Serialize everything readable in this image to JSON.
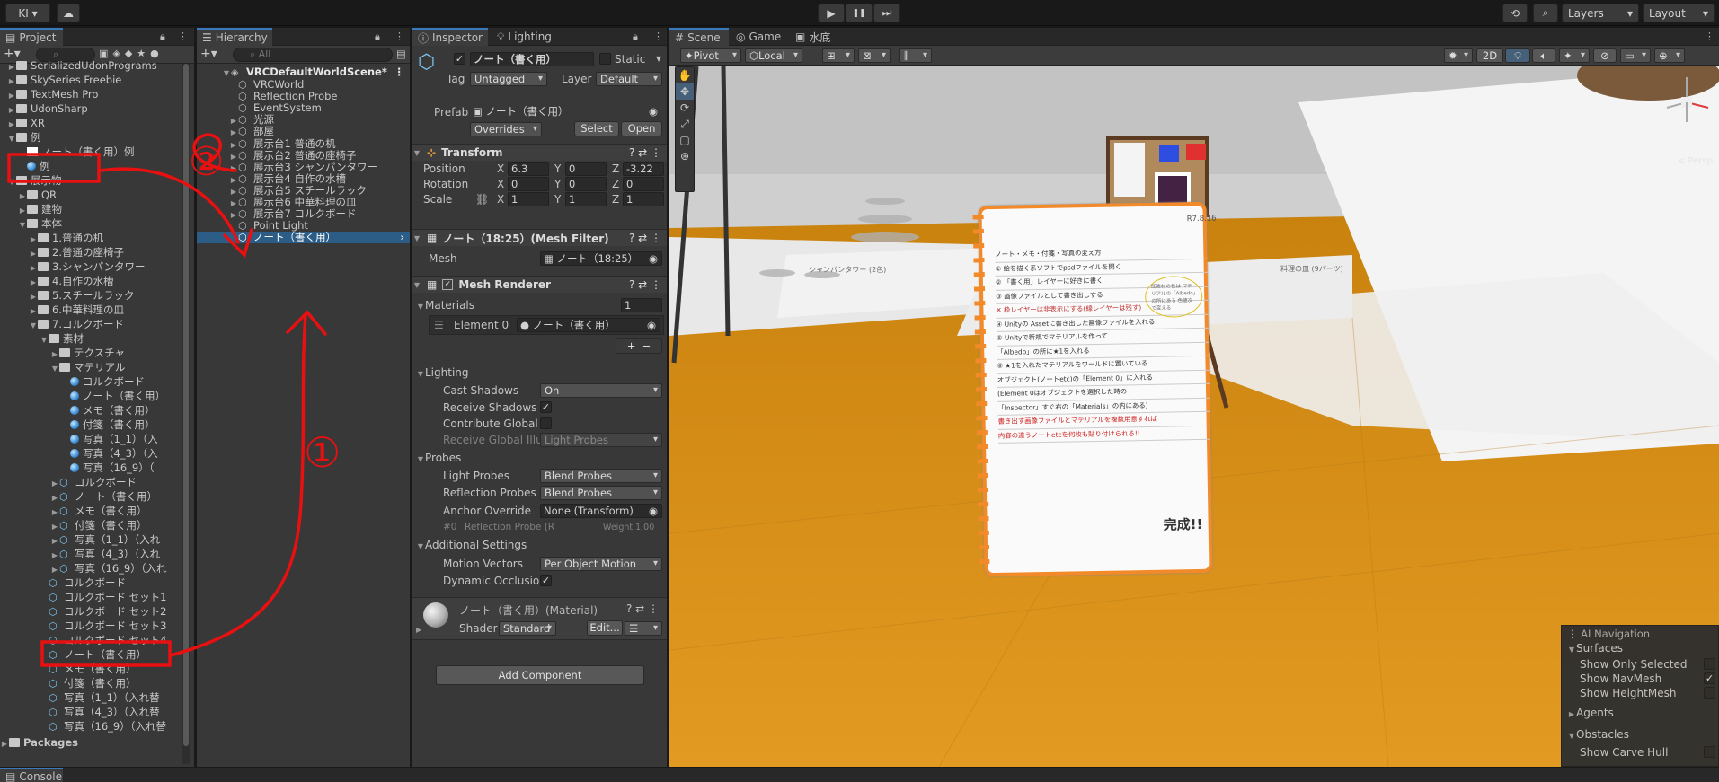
{
  "topbar": {
    "account": "KI",
    "play_icon": "▶",
    "pause_icon": "❚❚",
    "step_icon": "⏭",
    "layers": "Layers",
    "layout": "Layout"
  },
  "project": {
    "tab": "Project",
    "items": [
      {
        "label": "SerializedUdonPrograms",
        "indent": 1,
        "type": "folder",
        "arrow": "▶"
      },
      {
        "label": "SkySeries Freebie",
        "indent": 1,
        "type": "folder",
        "arrow": "▶"
      },
      {
        "label": "TextMesh Pro",
        "indent": 1,
        "type": "folder",
        "arrow": "▶"
      },
      {
        "label": "UdonSharp",
        "indent": 1,
        "type": "folder",
        "arrow": "▶"
      },
      {
        "label": "XR",
        "indent": 1,
        "type": "folder",
        "arrow": "▶"
      },
      {
        "label": "例",
        "indent": 1,
        "type": "folder",
        "arrow": "▼"
      },
      {
        "label": "ノート（書く用）例",
        "indent": 2,
        "type": "white",
        "arrow": ""
      },
      {
        "label": "例",
        "indent": 2,
        "type": "mat",
        "arrow": ""
      },
      {
        "label": "展示物",
        "indent": 1,
        "type": "folder",
        "arrow": "▼"
      },
      {
        "label": "QR",
        "indent": 2,
        "type": "folder",
        "arrow": "▶"
      },
      {
        "label": "建物",
        "indent": 2,
        "type": "folder",
        "arrow": "▶"
      },
      {
        "label": "本体",
        "indent": 2,
        "type": "folder",
        "arrow": "▼"
      },
      {
        "label": "1.普通の机",
        "indent": 3,
        "type": "folder",
        "arrow": "▶"
      },
      {
        "label": "2.普通の座椅子",
        "indent": 3,
        "type": "folder",
        "arrow": "▶"
      },
      {
        "label": "3.シャンパンタワー",
        "indent": 3,
        "type": "folder",
        "arrow": "▶"
      },
      {
        "label": "4.自作の水槽",
        "indent": 3,
        "type": "folder",
        "arrow": "▶"
      },
      {
        "label": "5.スチールラック",
        "indent": 3,
        "type": "folder",
        "arrow": "▶"
      },
      {
        "label": "6.中華料理の皿",
        "indent": 3,
        "type": "folder",
        "arrow": "▶"
      },
      {
        "label": "7.コルクボード",
        "indent": 3,
        "type": "folder",
        "arrow": "▼"
      },
      {
        "label": "素材",
        "indent": 4,
        "type": "folder",
        "arrow": "▼"
      },
      {
        "label": "テクスチャ",
        "indent": 5,
        "type": "folder",
        "arrow": "▶"
      },
      {
        "label": "マテリアル",
        "indent": 5,
        "type": "folder",
        "arrow": "▼"
      },
      {
        "label": "コルクボード",
        "indent": 6,
        "type": "mat",
        "arrow": ""
      },
      {
        "label": "ノート（書く用）",
        "indent": 6,
        "type": "mat",
        "arrow": ""
      },
      {
        "label": "メモ（書く用）",
        "indent": 6,
        "type": "mat",
        "arrow": ""
      },
      {
        "label": "付箋（書く用）",
        "indent": 6,
        "type": "mat",
        "arrow": ""
      },
      {
        "label": "写真（1_1）（入",
        "indent": 6,
        "type": "mat",
        "arrow": ""
      },
      {
        "label": "写真（4_3）（入",
        "indent": 6,
        "type": "mat",
        "arrow": ""
      },
      {
        "label": "写真（16_9）（",
        "indent": 6,
        "type": "mat",
        "arrow": ""
      },
      {
        "label": "コルクボード",
        "indent": 5,
        "type": "cube",
        "arrow": "▶"
      },
      {
        "label": "ノート（書く用）",
        "indent": 5,
        "type": "cube",
        "arrow": "▶"
      },
      {
        "label": "メモ（書く用）",
        "indent": 5,
        "type": "cube",
        "arrow": "▶"
      },
      {
        "label": "付箋（書く用）",
        "indent": 5,
        "type": "cube",
        "arrow": "▶"
      },
      {
        "label": "写真（1_1）（入れ",
        "indent": 5,
        "type": "cube",
        "arrow": "▶"
      },
      {
        "label": "写真（4_3）（入れ",
        "indent": 5,
        "type": "cube",
        "arrow": "▶"
      },
      {
        "label": "写真（16_9）（入れ",
        "indent": 5,
        "type": "cube",
        "arrow": "▶"
      },
      {
        "label": "コルクボード",
        "indent": 4,
        "type": "cube",
        "arrow": ""
      },
      {
        "label": "コルクボード セット1",
        "indent": 4,
        "type": "cube",
        "arrow": ""
      },
      {
        "label": "コルクボード セット2",
        "indent": 4,
        "type": "cube",
        "arrow": ""
      },
      {
        "label": "コルクボード セット3",
        "indent": 4,
        "type": "cube",
        "arrow": ""
      },
      {
        "label": "コルクボード セット4",
        "indent": 4,
        "type": "cube",
        "arrow": ""
      },
      {
        "label": "ノート（書く用）",
        "indent": 4,
        "type": "cube",
        "arrow": ""
      },
      {
        "label": "メモ（書く用）",
        "indent": 4,
        "type": "cube",
        "arrow": ""
      },
      {
        "label": "付箋（書く用）",
        "indent": 4,
        "type": "cube",
        "arrow": ""
      },
      {
        "label": "写真（1_1）（入れ替",
        "indent": 4,
        "type": "cube",
        "arrow": ""
      },
      {
        "label": "写真（4_3）（入れ替",
        "indent": 4,
        "type": "cube",
        "arrow": ""
      },
      {
        "label": "写真（16_9）（入れ替",
        "indent": 4,
        "type": "cube",
        "arrow": ""
      }
    ],
    "packages": "Packages"
  },
  "hierarchy": {
    "tab": "Hierarchy",
    "search_placeholder": "All",
    "scene": "VRCDefaultWorldScene*",
    "items": [
      {
        "label": "VRCWorld",
        "arrow": ""
      },
      {
        "label": "Reflection Probe",
        "arrow": ""
      },
      {
        "label": "EventSystem",
        "arrow": ""
      },
      {
        "label": "光源",
        "arrow": "▶"
      },
      {
        "label": "部屋",
        "arrow": "▶"
      },
      {
        "label": "展示台1 普通の机",
        "arrow": "▶"
      },
      {
        "label": "展示台2 普通の座椅子",
        "arrow": "▶"
      },
      {
        "label": "展示台3 シャンパンタワー",
        "arrow": "▶"
      },
      {
        "label": "展示台4 自作の水槽",
        "arrow": "▶"
      },
      {
        "label": "展示台5 スチールラック",
        "arrow": "▶"
      },
      {
        "label": "展示台6 中華料理の皿",
        "arrow": "▶"
      },
      {
        "label": "展示台7 コルクボード",
        "arrow": "▶"
      },
      {
        "label": "Point Light",
        "arrow": ""
      },
      {
        "label": "ノート（書く用）",
        "arrow": "",
        "selected": true,
        "cube": true
      }
    ]
  },
  "inspector": {
    "tab": "Inspector",
    "tab2": "Lighting",
    "object_name": "ノート（書く用）",
    "static": "Static",
    "tag_label": "Tag",
    "tag": "Untagged",
    "layer_label": "Layer",
    "layer": "Default",
    "prefab_label": "Prefab",
    "prefab": "ノート（書く用）",
    "overrides": "Overrides",
    "select": "Select",
    "open": "Open",
    "transform": {
      "title": "Transform",
      "position": "Position",
      "rotation": "Rotation",
      "scale": "Scale",
      "pos": [
        "6.3",
        "0",
        "-3.22"
      ],
      "rot": [
        "0",
        "0",
        "0"
      ],
      "scl": [
        "1",
        "1",
        "1"
      ],
      "x": "X",
      "y": "Y",
      "z": "Z"
    },
    "meshfilter": {
      "title": "ノート（18:25）(Mesh Filter)",
      "mesh_label": "Mesh",
      "mesh": "ノート（18:25）"
    },
    "renderer": {
      "title": "Mesh Renderer",
      "materials": "Materials",
      "materials_count": "1",
      "element0": "Element 0",
      "element0_value": "ノート（書く用）",
      "lighting": "Lighting",
      "cast": "Cast Shadows",
      "cast_v": "On",
      "receive": "Receive Shadows",
      "contribute": "Contribute Global I",
      "receive_gi": "Receive Global Illu",
      "receive_gi_v": "Light Probes",
      "probes": "Probes",
      "light_probes": "Light Probes",
      "light_probes_v": "Blend Probes",
      "refl_probes": "Reflection Probes",
      "refl_probes_v": "Blend Probes",
      "anchor": "Anchor Override",
      "anchor_v": "None (Transform)",
      "probe_idx": "#0",
      "probe_item": "Reflection Probe (R",
      "probe_weight": "Weight 1.00",
      "additional": "Additional Settings",
      "motion": "Motion Vectors",
      "motion_v": "Per Object Motion",
      "dyn": "Dynamic Occlusio"
    },
    "material": {
      "title": "ノート（書く用）(Material)",
      "shader_label": "Shader",
      "shader": "Standard",
      "edit": "Edit..."
    },
    "add_component": "Add Component"
  },
  "scene": {
    "tab": "Scene",
    "tab2": "Game",
    "tab3": "水底",
    "pivot": "Pivot",
    "local": "Local",
    "mode2d": "2D",
    "persp": "< Persp",
    "note": {
      "date": "R7.8.16",
      "lines": [
        "ノート・メモ・付箋・写真の変え方",
        "① 絵を描く系ソフトでpsdファイルを開く",
        "② 「書く用」レイヤーに好きに書く",
        "③ 画像ファイルとして書き出しする",
        "✕ 枠レイヤーは非表示にする(線レイヤーは残す)",
        "④ Unityの Assetに書き出した画像ファイルを入れる",
        "⑤ Unityで新規でマテリアルを作って",
        "「Albedo」の所に★1を入れる",
        "⑥ ★1を入れたマテリアルをワールドに置いている",
        "オブジェクト(ノートetc)の「Element 0」に入れる",
        "(Element 0はオブジェクトを選択した時の",
        "「Inspector」すぐ右の「Materials」の内にある)",
        "書き出す画像ファイルとマテリアルを複数用意すれば",
        "内容の違うノートetcを何枚も貼り付けられる!!"
      ],
      "bubble": "既素材の色は マテリアルの「Albedo」の所にある 色値次で変える",
      "star": "★1",
      "done": "完成!!"
    },
    "board_label": "シャンパンタワー (2色)",
    "board_label2": "料理の皿 (9パーツ)"
  },
  "ai_nav": {
    "title": "AI Navigation",
    "surfaces": "Surfaces",
    "show_selected": "Show Only Selected",
    "show_navmesh": "Show NavMesh",
    "show_height": "Show HeightMesh",
    "agents": "Agents",
    "obstacles": "Obstacles",
    "carve": "Show Carve Hull"
  },
  "console": {
    "tab": "Console"
  },
  "annotations": {
    "one": "①",
    "two": "②"
  }
}
